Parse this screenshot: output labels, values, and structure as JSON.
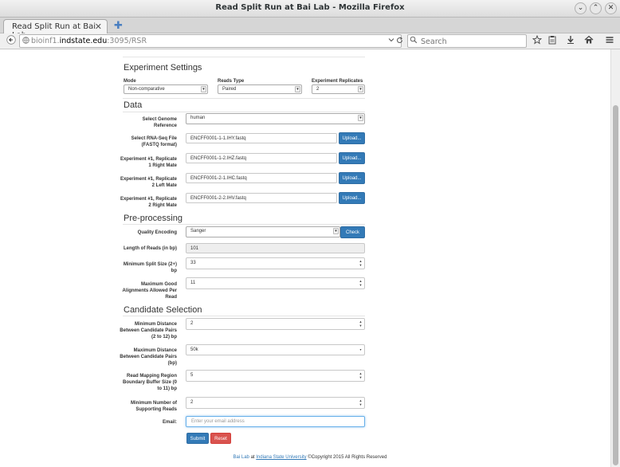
{
  "window": {
    "title": "Read Split Run at Bai Lab - Mozilla Firefox",
    "minimize_glyph": "⌄",
    "maximize_glyph": "⌃",
    "close_glyph": "✕"
  },
  "browser": {
    "tab_title": "Read Split Run at Bai Lab",
    "tab_close_glyph": "✕",
    "new_tab_glyph": "✚",
    "url_host_pre": "bioinf1.",
    "url_host": "indstate.edu",
    "url_rest": ":3095/RSR",
    "search_placeholder": "Search",
    "icons": [
      "back-icon",
      "globe-icon",
      "dropdown-icon",
      "reload-icon",
      "search-icon",
      "star-icon",
      "clipboard-icon",
      "download-icon",
      "home-icon",
      "menu-icon"
    ]
  },
  "settings": {
    "heading": "Experiment Settings",
    "mode_label": "Mode",
    "mode_value": "Non-comparative",
    "reads_type_label": "Reads Type",
    "reads_type_value": "Paired",
    "replicates_label": "Experiment Replicates",
    "replicates_value": "2"
  },
  "data": {
    "heading": "Data",
    "genome_label": "Select Genome Reference",
    "genome_value": "human",
    "files": [
      {
        "label": "Select RNA-Seq File (FASTQ format)",
        "value": "ENCFF0001-1-1.IHY.fastq",
        "button": "Upload..."
      },
      {
        "label": "Experiment #1, Replicate 1 Right Mate",
        "value": "ENCFF0001-1-2.IHZ.fastq",
        "button": "Upload..."
      },
      {
        "label": "Experiment #1, Replicate 2 Left Mate",
        "value": "ENCFF0001-2-1.IHC.fastq",
        "button": "Upload..."
      },
      {
        "label": "Experiment #1, Replicate 2 Right Mate",
        "value": "ENCFF0001-2-2.IHV.fastq",
        "button": "Upload..."
      }
    ]
  },
  "preprocessing": {
    "heading": "Pre-processing",
    "quality_label": "Quality Encoding",
    "quality_value": "Sanger",
    "check_button": "Check",
    "length_label": "Length of Reads (in bp)",
    "length_value": "101",
    "split_label": "Minimum Split Size (2+) bp",
    "split_value": "33",
    "align_label": "Maximum Good Alignments Allowed Per Read",
    "align_value": "11"
  },
  "candidate": {
    "heading": "Candidate Selection",
    "min_dist_label": "Minimum Distance Between Candidate Pairs (2 to 12) bp",
    "min_dist_value": "2",
    "max_dist_label": "Maximum Distance Between Candidate Pairs (bp)",
    "max_dist_value": "50k",
    "buffer_label": "Read Mapping Region Boundary Buffer Size (0 to 11) bp",
    "buffer_value": "5",
    "support_label": "Minimum Number of Supporting Reads",
    "support_value": "2",
    "email_label": "Email:",
    "email_placeholder": "Enter your email address",
    "submit": "Submit",
    "reset": "Reset"
  },
  "footer": {
    "lab": "Bai Lab",
    "at": " at ",
    "university": "Indiana State University",
    "copyright": " ©Copyright 2015 All Rights Reserved"
  },
  "colors": {
    "primary": "#337ab7",
    "danger": "#d9534f",
    "link": "#337ab7"
  }
}
